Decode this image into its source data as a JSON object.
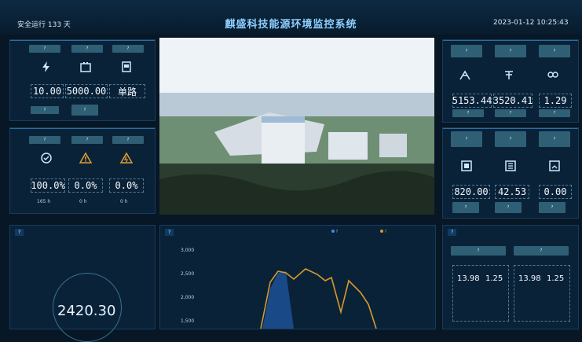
{
  "header": {
    "safety_label": "安全运行 133 天",
    "title": "麒盛科技能源环境监控系统",
    "datetime": "2023-01-12 10:25:43"
  },
  "left_top": {
    "chips": [
      "?",
      "?",
      "?"
    ],
    "values": [
      "10.00",
      "5000.00",
      "单路"
    ],
    "unit_chips": [
      "?",
      "?"
    ],
    "icons": [
      "lightning-icon",
      "battery-icon",
      "meter-icon"
    ]
  },
  "left_mid": {
    "chips": [
      "?",
      "?",
      "?"
    ],
    "values": [
      "100.0%",
      "0.0%",
      "0.0%"
    ],
    "foot": [
      "165 h",
      "0 h",
      "0 h"
    ],
    "icons": [
      "check-circle-icon",
      "warning-icon",
      "fault-icon"
    ]
  },
  "right_top": {
    "chips": [
      "?",
      "?",
      "?"
    ],
    "values": [
      "5153.44",
      "3520.41",
      "1.29"
    ],
    "unit_chips": [
      "?",
      "?",
      "?"
    ],
    "icons": [
      "solar-icon",
      "grid-tower-icon",
      "co2-icon"
    ]
  },
  "right_mid": {
    "chips": [
      "?",
      "?",
      "?"
    ],
    "values": [
      "820.00",
      "42.53",
      "0.00"
    ],
    "unit_chips": [
      "?",
      "?",
      "?"
    ],
    "icons": [
      "device-icon",
      "panel-icon",
      "screen-icon"
    ]
  },
  "bottom_left": {
    "title": "?",
    "value": "2420.30"
  },
  "bottom_mid": {
    "title": "?",
    "legend": [
      "?",
      "?"
    ],
    "yticks": [
      "3,000",
      "2,500",
      "2,000",
      "1,500"
    ]
  },
  "bottom_right": {
    "title": "?",
    "chips": [
      "?",
      "?"
    ],
    "values": [
      "13.98",
      "1.25",
      "13.98",
      "1.25"
    ]
  },
  "colors": {
    "accent": "#2a6fa3",
    "chip": "#2f5f75",
    "line1": "#d89a2a",
    "line2": "#3c8ee8"
  }
}
